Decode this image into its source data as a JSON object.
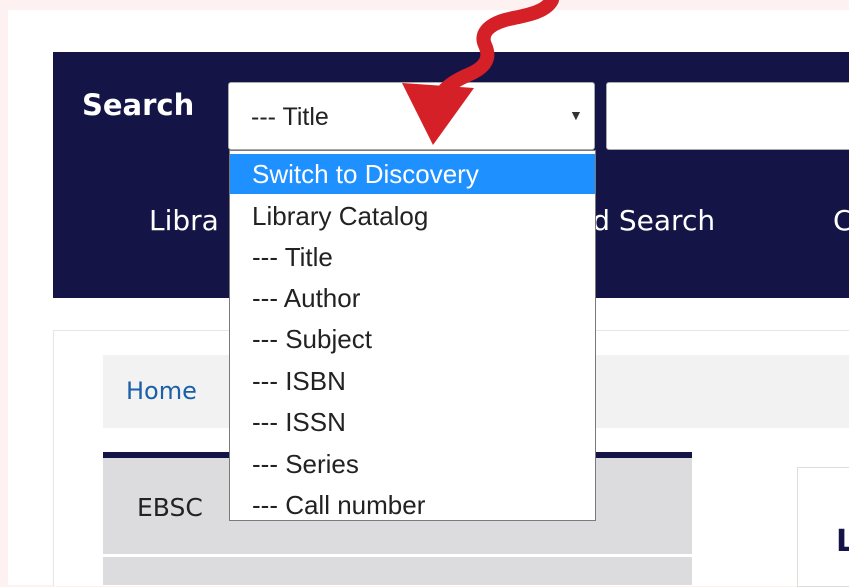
{
  "header": {
    "search_label": "Search",
    "search_select_value": "--- Title",
    "nav": {
      "library_catalog_partial": "Libra",
      "advanced_search_partial": "ed Search",
      "cut_item_partial": "C"
    }
  },
  "dropdown": {
    "options": [
      "Switch to Discovery",
      "Library Catalog",
      "--- Title",
      "--- Author",
      "--- Subject",
      "--- ISBN",
      "--- ISSN",
      "--- Series",
      "--- Call number"
    ],
    "highlighted_index": 0
  },
  "breadcrumb": {
    "home": "Home"
  },
  "sidebar": {
    "first_item_partial": "EBSC"
  },
  "right_panel": {
    "title_partial": "L"
  },
  "colors": {
    "header_bg": "#141546",
    "highlight": "#1e90ff",
    "arrow": "#d42026",
    "link": "#1a5fa8"
  },
  "icons": {
    "select_arrow": "triangle-down-icon",
    "annotation_arrow": "curved-arrow-icon"
  }
}
